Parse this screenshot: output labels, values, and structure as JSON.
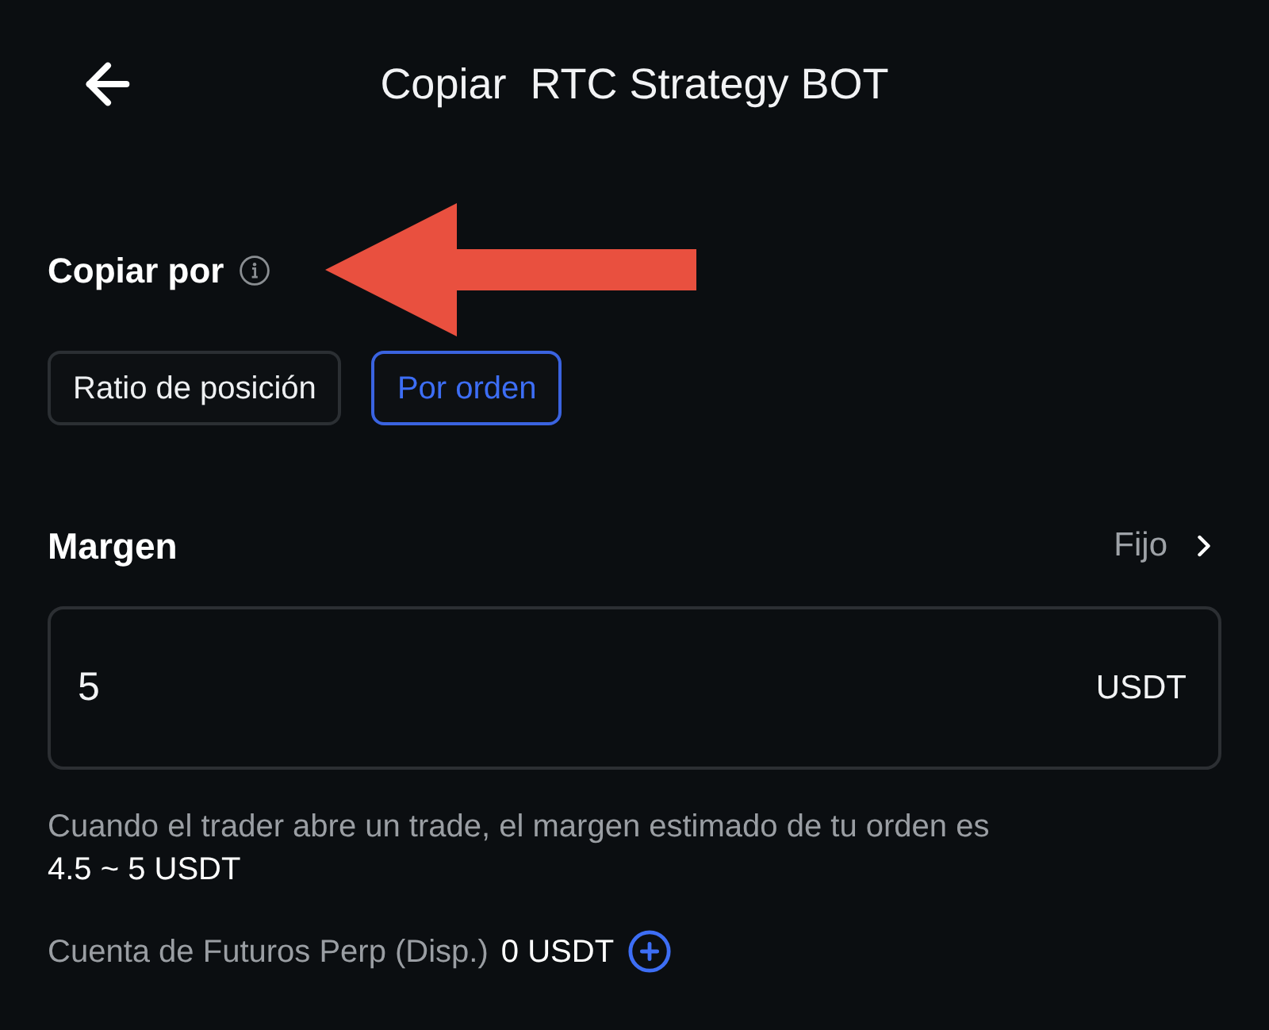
{
  "header": {
    "title": "Copiar  RTC Strategy BOT"
  },
  "copy_by": {
    "label": "Copiar por",
    "options": [
      {
        "label": "Ratio de posición",
        "selected": false
      },
      {
        "label": "Por orden",
        "selected": true
      }
    ]
  },
  "margin": {
    "label": "Margen",
    "mode": "Fijo",
    "value": "5",
    "unit": "USDT",
    "hint": "Cuando el trader abre un trade, el margen estimado de tu orden es",
    "estimate": "4.5 ~ 5 USDT"
  },
  "account": {
    "label": "Cuenta de Futuros Perp (Disp.)",
    "balance": "0 USDT"
  }
}
